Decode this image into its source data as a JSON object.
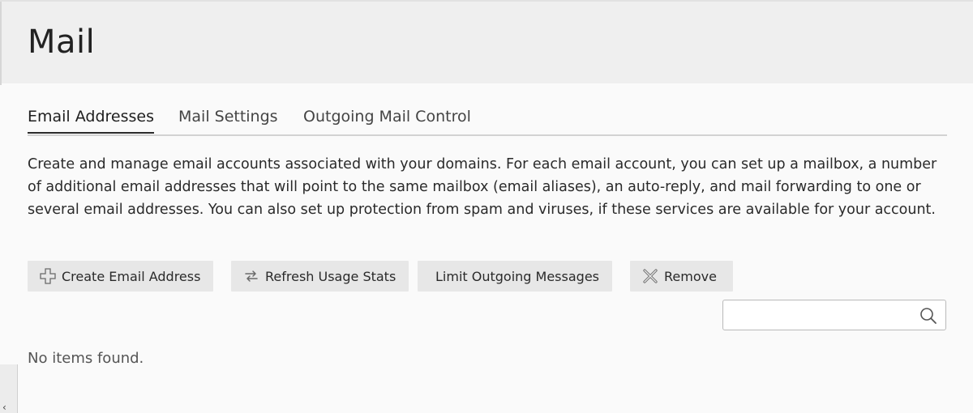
{
  "page": {
    "title": "Mail"
  },
  "tabs": [
    {
      "label": "Email Addresses",
      "active": true
    },
    {
      "label": "Mail Settings",
      "active": false
    },
    {
      "label": "Outgoing Mail Control",
      "active": false
    }
  ],
  "description": "Create and manage email accounts associated with your domains. For each email account, you can set up a mailbox, a number of additional email addresses that will point to the same mailbox (email aliases), an auto-reply, and mail forwarding to one or several email addresses. You can also set up protection from spam and viruses, if these services are available for your account.",
  "toolbar": {
    "create_label": "Create Email Address",
    "create_icon": "plus-icon",
    "refresh_label": "Refresh Usage Stats",
    "refresh_icon": "refresh-icon",
    "limit_label": "Limit Outgoing Messages",
    "remove_label": "Remove",
    "remove_icon": "remove-icon"
  },
  "search": {
    "value": "",
    "placeholder": "",
    "icon": "search-icon"
  },
  "list": {
    "empty_text": "No items found."
  },
  "sidebar_toggle": {
    "glyph": "‹",
    "icon": "chevron-left-icon"
  },
  "colors": {
    "header_bg": "#efefef",
    "page_bg": "#fafafa",
    "button_bg": "#e7e7e7",
    "tab_underline": "#2b2b2b"
  }
}
